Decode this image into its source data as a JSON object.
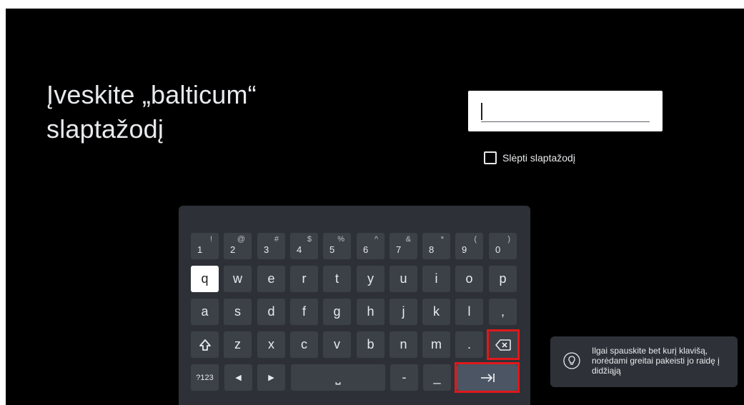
{
  "title": {
    "line1": "Įveskite „balticum“",
    "line2": "slaptažodį"
  },
  "password": {
    "value": "",
    "placeholder": ""
  },
  "hide_password": {
    "label": "Slėpti slaptažodį",
    "checked": false
  },
  "keyboard": {
    "number_row": [
      {
        "main": "1",
        "alt": "!"
      },
      {
        "main": "2",
        "alt": "@"
      },
      {
        "main": "3",
        "alt": "#"
      },
      {
        "main": "4",
        "alt": "$"
      },
      {
        "main": "5",
        "alt": "%"
      },
      {
        "main": "6",
        "alt": "^"
      },
      {
        "main": "7",
        "alt": "&"
      },
      {
        "main": "8",
        "alt": "*"
      },
      {
        "main": "9",
        "alt": "("
      },
      {
        "main": "0",
        "alt": ")"
      }
    ],
    "row1": [
      "q",
      "w",
      "e",
      "r",
      "t",
      "y",
      "u",
      "i",
      "o",
      "p"
    ],
    "row2": [
      "a",
      "s",
      "d",
      "f",
      "g",
      "h",
      "j",
      "k",
      "l",
      ","
    ],
    "row3": [
      "z",
      "x",
      "c",
      "v",
      "b",
      "n",
      "m",
      "."
    ],
    "symbols_label": "?123",
    "left_arrow": "◀",
    "right_arrow": "▶",
    "space_label": "⎵",
    "dash": "-",
    "underscore": "_",
    "shift_icon": "shift-icon",
    "backspace_icon": "backspace-icon",
    "tab_icon": "tab-icon",
    "focused_key": "q"
  },
  "tip": {
    "icon": "lightbulb-icon",
    "text": "Ilgai spauskite bet kurį klavišą, norėdami greitai pakeisti jo raidę į didžiąją"
  },
  "colors": {
    "background": "#000000",
    "keyboard": "#2d3137",
    "key": "#3c4148",
    "highlight": "#e0181b",
    "text": "#e8eaed"
  }
}
